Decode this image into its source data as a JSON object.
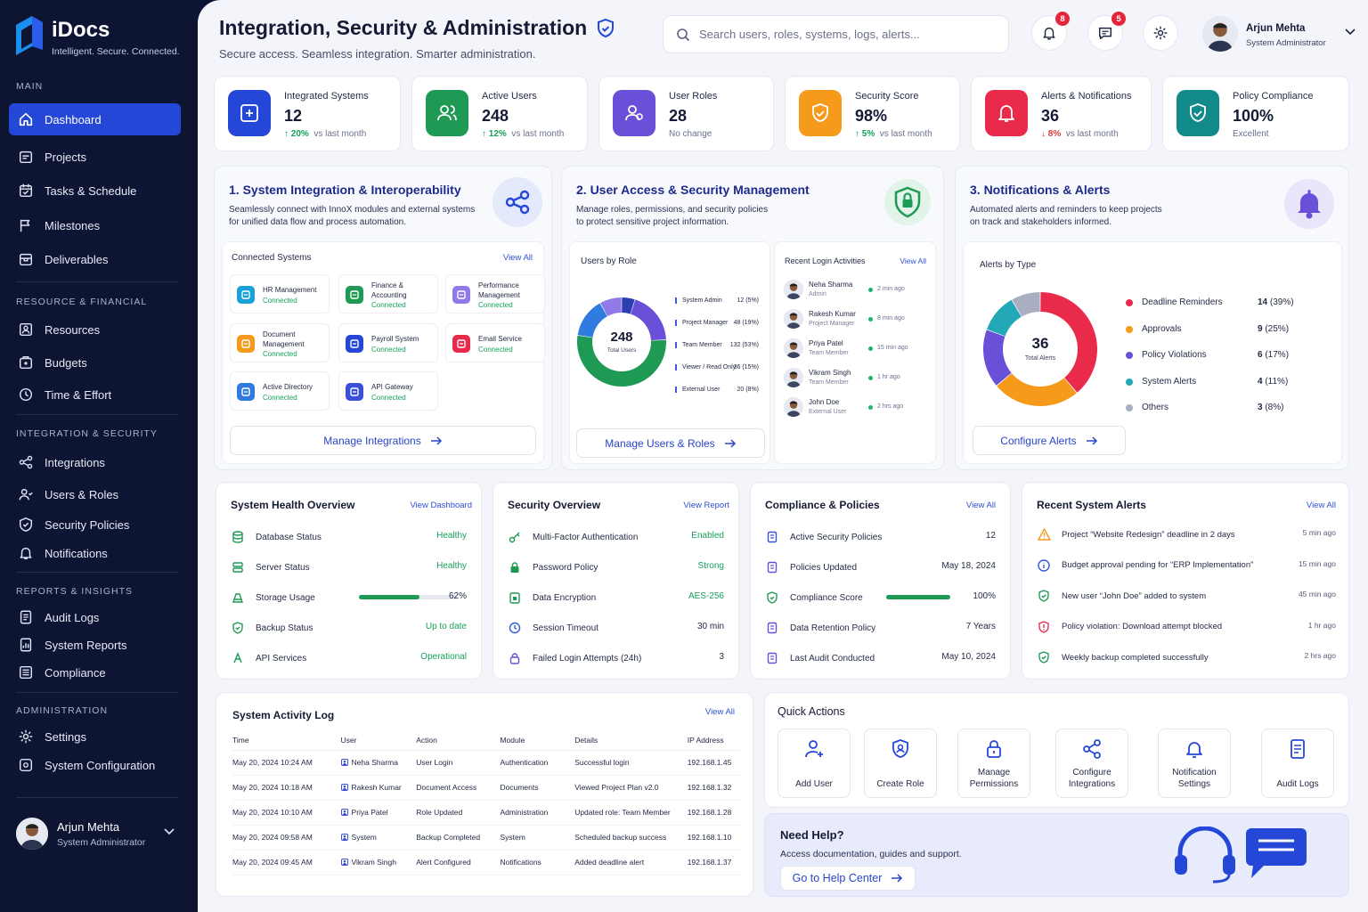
{
  "app": {
    "name": "iDocs",
    "tagline": "Intelligent. Secure. Connected."
  },
  "sidebar": {
    "sections": [
      {
        "title": "MAIN",
        "items": [
          {
            "label": "Dashboard",
            "icon": "home-icon",
            "active": true
          },
          {
            "label": "Projects",
            "icon": "folder-icon"
          },
          {
            "label": "Tasks & Schedule",
            "icon": "calendar-check-icon"
          },
          {
            "label": "Milestones",
            "icon": "flag-icon"
          },
          {
            "label": "Deliverables",
            "icon": "package-icon"
          }
        ]
      },
      {
        "title": "RESOURCE & FINANCIAL",
        "items": [
          {
            "label": "Resources",
            "icon": "people-icon"
          },
          {
            "label": "Budgets",
            "icon": "wallet-icon"
          },
          {
            "label": "Time & Effort",
            "icon": "clock-icon"
          }
        ]
      },
      {
        "title": "INTEGRATION & SECURITY",
        "items": [
          {
            "label": "Integrations",
            "icon": "share-icon"
          },
          {
            "label": "Users & Roles",
            "icon": "users-icon"
          },
          {
            "label": "Security Policies",
            "icon": "shield-icon"
          },
          {
            "label": "Notifications",
            "icon": "bell-icon"
          }
        ]
      },
      {
        "title": "REPORTS & INSIGHTS",
        "items": [
          {
            "label": "Audit Logs",
            "icon": "doc-icon"
          },
          {
            "label": "System Reports",
            "icon": "report-icon"
          },
          {
            "label": "Compliance",
            "icon": "list-icon"
          }
        ]
      },
      {
        "title": "ADMINISTRATION",
        "items": [
          {
            "label": "Settings",
            "icon": "gear-icon"
          },
          {
            "label": "System Configuration",
            "icon": "config-icon"
          }
        ]
      }
    ],
    "user": {
      "name": "Arjun Mehta",
      "role": "System Administrator"
    }
  },
  "header": {
    "title": "Integration, Security & Administration",
    "subtitle": "Secure access. Seamless integration. Smarter administration.",
    "search_placeholder": "Search users, roles, systems, logs, alerts...",
    "notifications_count": "8",
    "messages_count": "5",
    "user": {
      "name": "Arjun Mehta",
      "role": "System Administrator"
    }
  },
  "kpis": [
    {
      "label": "Integrated Systems",
      "value": "12",
      "trend": "20%",
      "trend_dir": "up",
      "note": "vs last month",
      "color": "#2447d8"
    },
    {
      "label": "Active Users",
      "value": "248",
      "trend": "12%",
      "trend_dir": "up",
      "note": "vs last month",
      "color": "#1f9a55"
    },
    {
      "label": "User Roles",
      "value": "28",
      "trend": "",
      "trend_dir": "none",
      "note": "No change",
      "color": "#6a4fd8"
    },
    {
      "label": "Security Score",
      "value": "98%",
      "trend": "5%",
      "trend_dir": "up",
      "note": "vs last month",
      "color": "#f59a1a"
    },
    {
      "label": "Alerts & Notifications",
      "value": "36",
      "trend": "8%",
      "trend_dir": "down",
      "note": "vs last month",
      "color": "#ea2a4a"
    },
    {
      "label": "Policy Compliance",
      "value": "100%",
      "trend": "",
      "trend_dir": "none",
      "note": "Excellent",
      "color": "#138a8a"
    }
  ],
  "integration": {
    "title": "1. System Integration & Interoperability",
    "desc1": "Seamlessly connect with InnoX modules and external systems",
    "desc2": "for unified data flow and process automation.",
    "connected_title": "Connected Systems",
    "view_all": "View All",
    "systems": [
      {
        "name": "HR Management",
        "status": "Connected",
        "color": "#1aa0d8"
      },
      {
        "name": "Finance & Accounting",
        "status": "Connected",
        "color": "#1f9a55"
      },
      {
        "name": "Performance Management",
        "status": "Connected",
        "color": "#8f7ae8"
      },
      {
        "name": "Document Management",
        "status": "Connected",
        "color": "#f59a1a"
      },
      {
        "name": "Payroll System",
        "status": "Connected",
        "color": "#2447d8"
      },
      {
        "name": "Email Service",
        "status": "Connected",
        "color": "#ea2a4a"
      },
      {
        "name": "Active Directory",
        "status": "Connected",
        "color": "#2f7be0"
      },
      {
        "name": "API Gateway",
        "status": "Connected",
        "color": "#3b4fd8"
      }
    ],
    "button": "Manage Integrations"
  },
  "user_access": {
    "title": "2. User Access & Security Management",
    "desc1": "Manage roles, permissions, and security policies",
    "desc2": "to protect sensitive project information.",
    "users_by_role_title": "Users by Role",
    "donut_value": "248",
    "donut_label": "Total Users",
    "roles": [
      {
        "name": "System Admin",
        "count": "12 (5%)",
        "value": 12,
        "color": "#2c3fb0"
      },
      {
        "name": "Project Manager",
        "count": "48 (19%)",
        "value": 48,
        "color": "#6a4fd8"
      },
      {
        "name": "Team Member",
        "count": "132 (53%)",
        "value": 132,
        "color": "#1f9a55"
      },
      {
        "name": "Viewer / Read Only",
        "count": "36 (15%)",
        "value": 36,
        "color": "#2f7be0"
      },
      {
        "name": "External User",
        "count": "20 (8%)",
        "value": 20,
        "color": "#8f7ae8"
      }
    ],
    "logins_title": "Recent Login Activities",
    "view_all": "View All",
    "logins": [
      {
        "name": "Neha Sharma",
        "role": "Admin",
        "time": "2 min ago"
      },
      {
        "name": "Rakesh Kumar",
        "role": "Project Manager",
        "time": "8 min ago"
      },
      {
        "name": "Priya Patel",
        "role": "Team Member",
        "time": "15 min ago"
      },
      {
        "name": "Vikram Singh",
        "role": "Team Member",
        "time": "1 hr ago"
      },
      {
        "name": "John Doe",
        "role": "External User",
        "time": "2 hrs ago"
      }
    ],
    "button": "Manage Users & Roles"
  },
  "notifications": {
    "title": "3. Notifications & Alerts",
    "desc1": "Automated alerts and reminders to keep projects",
    "desc2": "on track and stakeholders informed.",
    "alerts_by_type_title": "Alerts by Type",
    "donut_value": "36",
    "donut_label": "Total Alerts",
    "types": [
      {
        "name": "Deadline Reminders",
        "count": "14",
        "pct": "(39%)",
        "value": 14,
        "color": "#ea2a4a"
      },
      {
        "name": "Approvals",
        "count": "9",
        "pct": "(25%)",
        "value": 9,
        "color": "#f59a1a"
      },
      {
        "name": "Policy Violations",
        "count": "6",
        "pct": "(17%)",
        "value": 6,
        "color": "#6a4fd8"
      },
      {
        "name": "System Alerts",
        "count": "4",
        "pct": "(11%)",
        "value": 4,
        "color": "#23a8b8"
      },
      {
        "name": "Others",
        "count": "3",
        "pct": "(8%)",
        "value": 3,
        "color": "#a9aec2"
      }
    ],
    "button": "Configure Alerts"
  },
  "system_health": {
    "title": "System Health Overview",
    "link": "View Dashboard",
    "rows": [
      {
        "label": "Database Status",
        "value": "Healthy"
      },
      {
        "label": "Server Status",
        "value": "Healthy"
      },
      {
        "label": "Storage Usage",
        "value": "62%",
        "progress": 0.62
      },
      {
        "label": "Backup Status",
        "value": "Up to date"
      },
      {
        "label": "API Services",
        "value": "Operational"
      }
    ]
  },
  "security_overview": {
    "title": "Security Overview",
    "link": "View Report",
    "rows": [
      {
        "label": "Multi-Factor Authentication",
        "value": "Enabled"
      },
      {
        "label": "Password Policy",
        "value": "Strong"
      },
      {
        "label": "Data Encryption",
        "value": "AES-256"
      },
      {
        "label": "Session Timeout",
        "value": "30 min"
      },
      {
        "label": "Failed Login Attempts (24h)",
        "value": "3"
      }
    ]
  },
  "compliance": {
    "title": "Compliance & Policies",
    "link": "View All",
    "rows": [
      {
        "label": "Active Security Policies",
        "value": "12"
      },
      {
        "label": "Policies Updated",
        "value": "May 18, 2024"
      },
      {
        "label": "Compliance Score",
        "value": "100%",
        "progress": 1.0
      },
      {
        "label": "Data Retention Policy",
        "value": "7 Years"
      },
      {
        "label": "Last Audit Conducted",
        "value": "May 10, 2024"
      }
    ]
  },
  "recent_alerts": {
    "title": "Recent System Alerts",
    "link": "View All",
    "rows": [
      {
        "text": "Project “Website Redesign” deadline in 2 days",
        "time": "5 min ago",
        "icon": "warning-icon",
        "color": "#f59a1a"
      },
      {
        "text": "Budget approval pending for “ERP Implementation”",
        "time": "15 min ago",
        "icon": "info-icon",
        "color": "#2f5be0"
      },
      {
        "text": "New user “John Doe” added to system",
        "time": "45 min ago",
        "icon": "check-icon",
        "color": "#1f9a55"
      },
      {
        "text": "Policy violation: Download attempt blocked",
        "time": "1 hr ago",
        "icon": "shield-alert-icon",
        "color": "#ea2a4a"
      },
      {
        "text": "Weekly backup completed successfully",
        "time": "2 hrs ago",
        "icon": "check-icon",
        "color": "#1f9a55"
      }
    ]
  },
  "activity_log": {
    "title": "System Activity Log",
    "link": "View All",
    "columns": [
      "Time",
      "User",
      "Action",
      "Module",
      "Details",
      "IP Address"
    ],
    "rows": [
      [
        "May 20, 2024 10:24 AM",
        "Neha Sharma",
        "User Login",
        "Authentication",
        "Successful login",
        "192.168.1.45"
      ],
      [
        "May 20, 2024 10:18 AM",
        "Rakesh Kumar",
        "Document Access",
        "Documents",
        "Viewed Project Plan v2.0",
        "192.168.1.32"
      ],
      [
        "May 20, 2024 10:10 AM",
        "Priya Patel",
        "Role Updated",
        "Administration",
        "Updated role: Team Member",
        "192.168.1.28"
      ],
      [
        "May 20, 2024 09:58 AM",
        "System",
        "Backup Completed",
        "System",
        "Scheduled backup success",
        "192.168.1.10"
      ],
      [
        "May 20, 2024 09:45 AM",
        "Vikram Singh",
        "Alert Configured",
        "Notifications",
        "Added deadline alert",
        "192.168.1.37"
      ]
    ]
  },
  "quick_actions": {
    "title": "Quick Actions",
    "items": [
      {
        "label": "Add User",
        "icon": "add-user-icon"
      },
      {
        "label": "Create Role",
        "icon": "create-role-icon"
      },
      {
        "label": "Manage Permissions",
        "icon": "lock-icon"
      },
      {
        "label": "Configure Integrations",
        "icon": "share-icon"
      },
      {
        "label": "Notification Settings",
        "icon": "bell-icon"
      },
      {
        "label": "Audit Logs",
        "icon": "doc-icon"
      }
    ]
  },
  "help": {
    "title": "Need Help?",
    "desc": "Access documentation, guides and support.",
    "button": "Go to Help Center"
  }
}
